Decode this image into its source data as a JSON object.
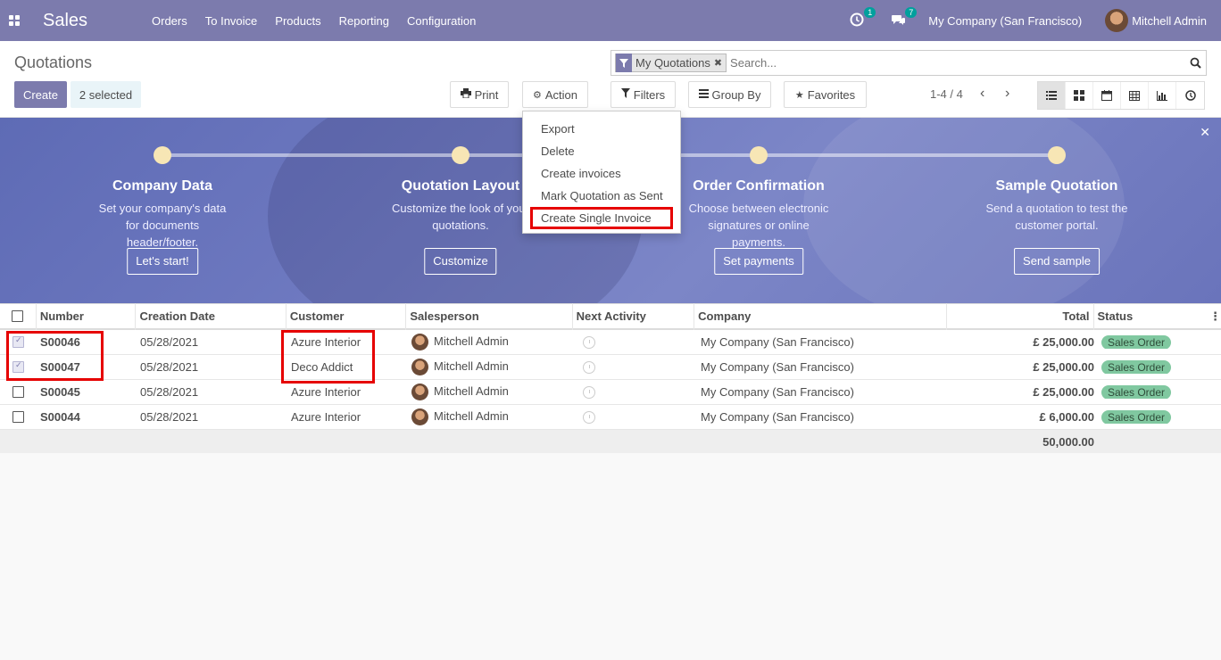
{
  "navbar": {
    "app_name": "Sales",
    "menu": [
      "Orders",
      "To Invoice",
      "Products",
      "Reporting",
      "Configuration"
    ],
    "activity_badge": "1",
    "messages_badge": "7",
    "company": "My Company (San Francisco)",
    "user": "Mitchell Admin"
  },
  "control": {
    "title": "Quotations",
    "create_label": "Create",
    "selected_label": "2 selected",
    "print_label": "Print",
    "action_label": "Action",
    "filters_label": "Filters",
    "groupby_label": "Group By",
    "favorites_label": "Favorites",
    "pager": "1-4 / 4",
    "facet": "My Quotations",
    "search_placeholder": "Search..."
  },
  "action_menu": [
    "Export",
    "Delete",
    "Create invoices",
    "Mark Quotation as Sent",
    "Create Single Invoice"
  ],
  "banner": {
    "steps": [
      {
        "title": "Company Data",
        "desc": "Set your company's data for documents header/footer.",
        "button": "Let's start!"
      },
      {
        "title": "Quotation Layout",
        "desc": "Customize the look of your quotations.",
        "button": "Customize"
      },
      {
        "title": "Order Confirmation",
        "desc": "Choose between electronic signatures or online payments.",
        "button": "Set payments"
      },
      {
        "title": "Sample Quotation",
        "desc": "Send a quotation to test the customer portal.",
        "button": "Send sample"
      }
    ]
  },
  "table": {
    "columns": [
      "Number",
      "Creation Date",
      "Customer",
      "Salesperson",
      "Next Activity",
      "Company",
      "Total",
      "Status"
    ],
    "rows": [
      {
        "number": "S00046",
        "date": "05/28/2021",
        "customer": "Azure Interior",
        "salesperson": "Mitchell Admin",
        "company": "My Company (San Francisco)",
        "total": "£ 25,000.00",
        "status": "Sales Order",
        "checked": true
      },
      {
        "number": "S00047",
        "date": "05/28/2021",
        "customer": "Deco Addict",
        "salesperson": "Mitchell Admin",
        "company": "My Company (San Francisco)",
        "total": "£ 25,000.00",
        "status": "Sales Order",
        "checked": true
      },
      {
        "number": "S00045",
        "date": "05/28/2021",
        "customer": "Azure Interior",
        "salesperson": "Mitchell Admin",
        "company": "My Company (San Francisco)",
        "total": "£ 25,000.00",
        "status": "Sales Order",
        "checked": false
      },
      {
        "number": "S00044",
        "date": "05/28/2021",
        "customer": "Azure Interior",
        "salesperson": "Mitchell Admin",
        "company": "My Company (San Francisco)",
        "total": "£ 6,000.00",
        "status": "Sales Order",
        "checked": false
      }
    ],
    "grand_total": "50,000.00"
  },
  "colors": {
    "brand": "#7c7bad",
    "status_badge": "#80c8a0",
    "highlight": "#e60000"
  }
}
